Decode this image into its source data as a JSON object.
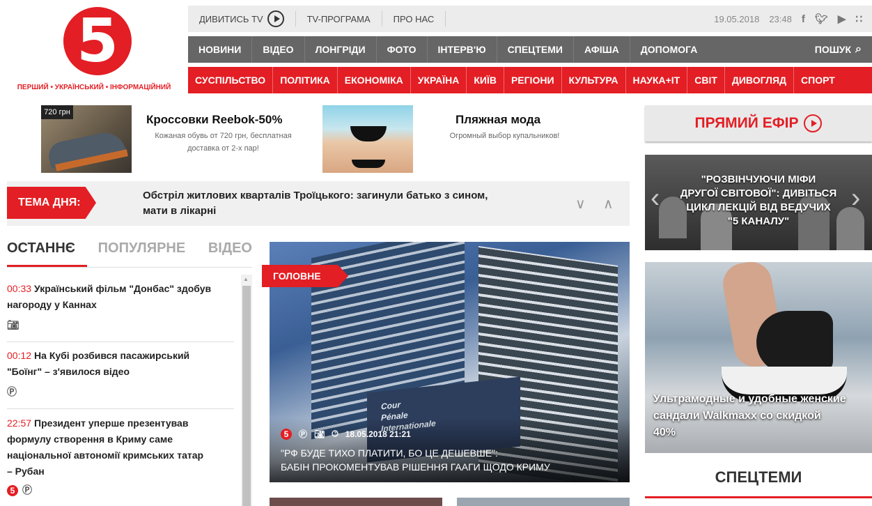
{
  "logo": {
    "digit": "5",
    "tagline": "ПЕРШИЙ • УКРАЇНСЬКИЙ • ІНФОРМАЦІЙНИЙ"
  },
  "topbar": {
    "watch": "ДИВИТИСЬ TV",
    "tvprogram": "TV-ПРОГРАМА",
    "about": "ПРО НАС",
    "date": "19.05.2018",
    "time": "23:48"
  },
  "nav_main": [
    "НОВИНИ",
    "ВІДЕО",
    "ЛОНГРІДИ",
    "ФОТО",
    "ІНТЕРВ'Ю",
    "СПЕЦТЕМИ",
    "АФІША",
    "ДОПОМОГА"
  ],
  "search_label": "ПОШУК",
  "nav_sections": [
    "СУСПІЛЬСТВО",
    "ПОЛІТИКА",
    "ЕКОНОМІКА",
    "УКРАЇНА",
    "КИЇВ",
    "РЕГІОНИ",
    "КУЛЬТУРА",
    "НАУКА+IT",
    "СВІТ",
    "ДИВОГЛЯД",
    "СПОРТ"
  ],
  "ads": {
    "shoes": {
      "price": "720 грн",
      "title": "Кроссовки Reebok-50%",
      "sub1": "Кожаная обувь от 720 грн, бесплатная",
      "sub2": "доставка от 2-х пар!"
    },
    "beach": {
      "title": "Пляжная мода",
      "sub": "Огромный выбор купальников!"
    }
  },
  "live": {
    "label": "ПРЯМИЙ ЕФІР"
  },
  "tema": {
    "label": "ТЕМА ДНЯ:",
    "line1": "Обстріл житлових кварталів Троїцького: загинули батько з сином,",
    "line2": "мати в лікарні"
  },
  "tabs": [
    "ОСТАННЄ",
    "ПОПУЛЯРНЕ",
    "ВІДЕО"
  ],
  "news": [
    {
      "time": "00:33",
      "l1": "Український фільм \"Донбас\" здобув",
      "l2": "нагороду у Каннах"
    },
    {
      "time": "00:12",
      "l1": "На Кубі розбився пасажирський",
      "l2": "\"Боїнг\" – з'явилося відео"
    },
    {
      "time": "22:57",
      "l1": "Президент уперше презентував",
      "l2": "формулу створення в Криму саме",
      "l3": "національної автономії кримських татар",
      "l4": "– Рубан"
    }
  ],
  "main": {
    "badge": "ГОЛОВНЕ",
    "datetime": "18.05.2018 21:21",
    "line1": "\"РФ БУДЕ ТИХО ПЛАТИТИ, БО ЦЕ ДЕШЕВШЕ\":",
    "line2": "БАБІН ПРОКОМЕНТУВАВ РІШЕННЯ ГААГИ ЩОДО КРИМУ",
    "sign1": "Cour",
    "sign2": "Pénale",
    "sign3": "Internationale"
  },
  "lecture": {
    "l1": "\"РОЗВІНЧУЮЧИ МІФИ",
    "l2": "ДРУГОЇ СВІТОВОЇ\": ДИВІТЬСЯ",
    "l3": "ЦИКЛ ЛЕКЦІЙ ВІД ВЕДУЧИХ",
    "l4": "\"5 КАНАЛУ\""
  },
  "sandal_ad": {
    "l1": "Ультрамодные и удобные женские",
    "l2": "сандали Walkmaxx со скидкой",
    "l3": "40%"
  },
  "spectemi": "СПЕЦТЕМИ"
}
